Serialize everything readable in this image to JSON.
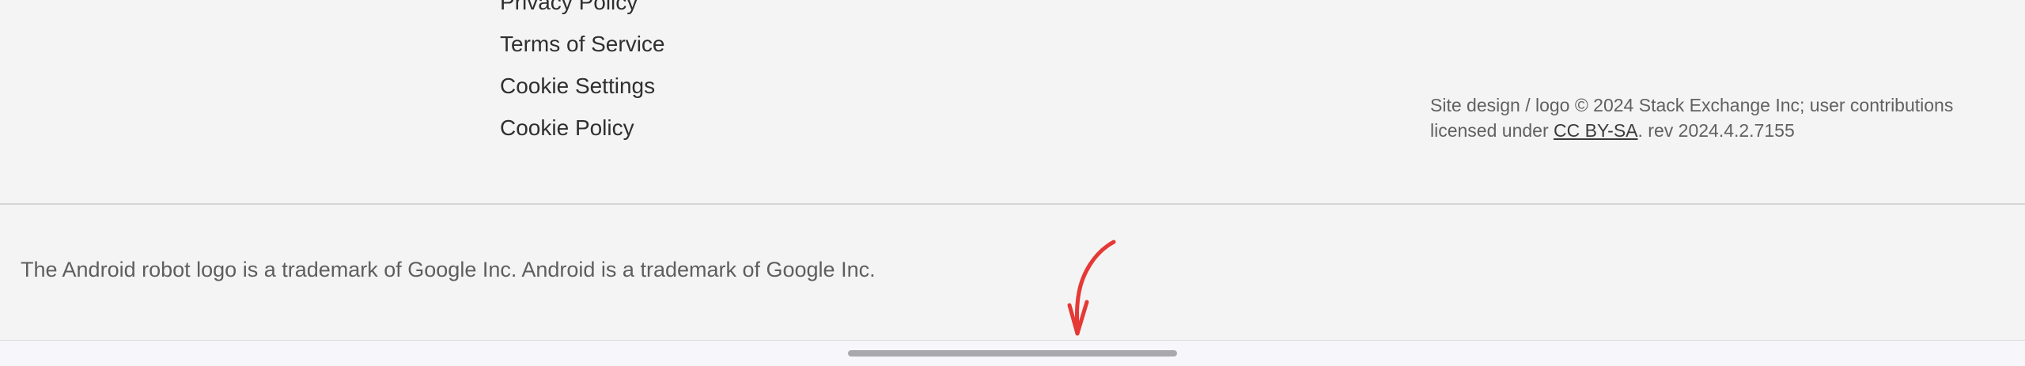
{
  "footer": {
    "links": [
      "Privacy Policy",
      "Terms of Service",
      "Cookie Settings",
      "Cookie Policy"
    ],
    "legal_prefix": "Site design / logo © 2024 Stack Exchange Inc; user contributions licensed under ",
    "license_link": "CC BY-SA",
    "legal_suffix": ". rev 2024.4.2.7155",
    "trademark": "The Android robot logo is a trademark of Google Inc. Android is a trademark of Google Inc."
  },
  "annotation": {
    "arrow_color": "#e53935",
    "icon": "arrow-down-icon"
  },
  "system": {
    "nav_handle_icon": "home-handle"
  }
}
